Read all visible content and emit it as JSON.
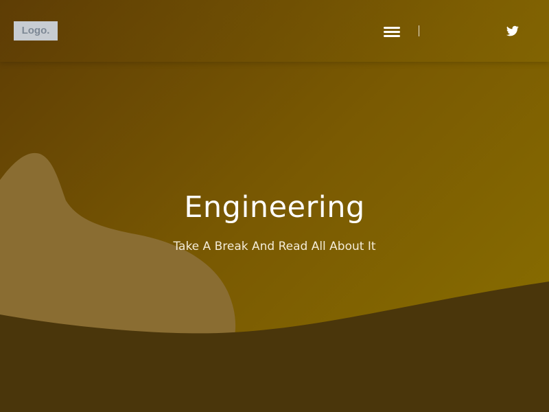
{
  "header": {
    "logo_text": "Logo.",
    "menu_icon": "hamburger-menu-icon",
    "social_icon": "twitter-icon"
  },
  "hero": {
    "title": "Engineering",
    "subtitle": "Take A Break And Read All About It"
  },
  "colors": {
    "gradient_start": "#5e3d05",
    "gradient_end": "#8a7000",
    "blob": "#8a6d32",
    "footer_wave": "#4a360b",
    "logo_bg": "#c7ccd2",
    "logo_text": "#7d8895",
    "text": "#ffffff"
  }
}
